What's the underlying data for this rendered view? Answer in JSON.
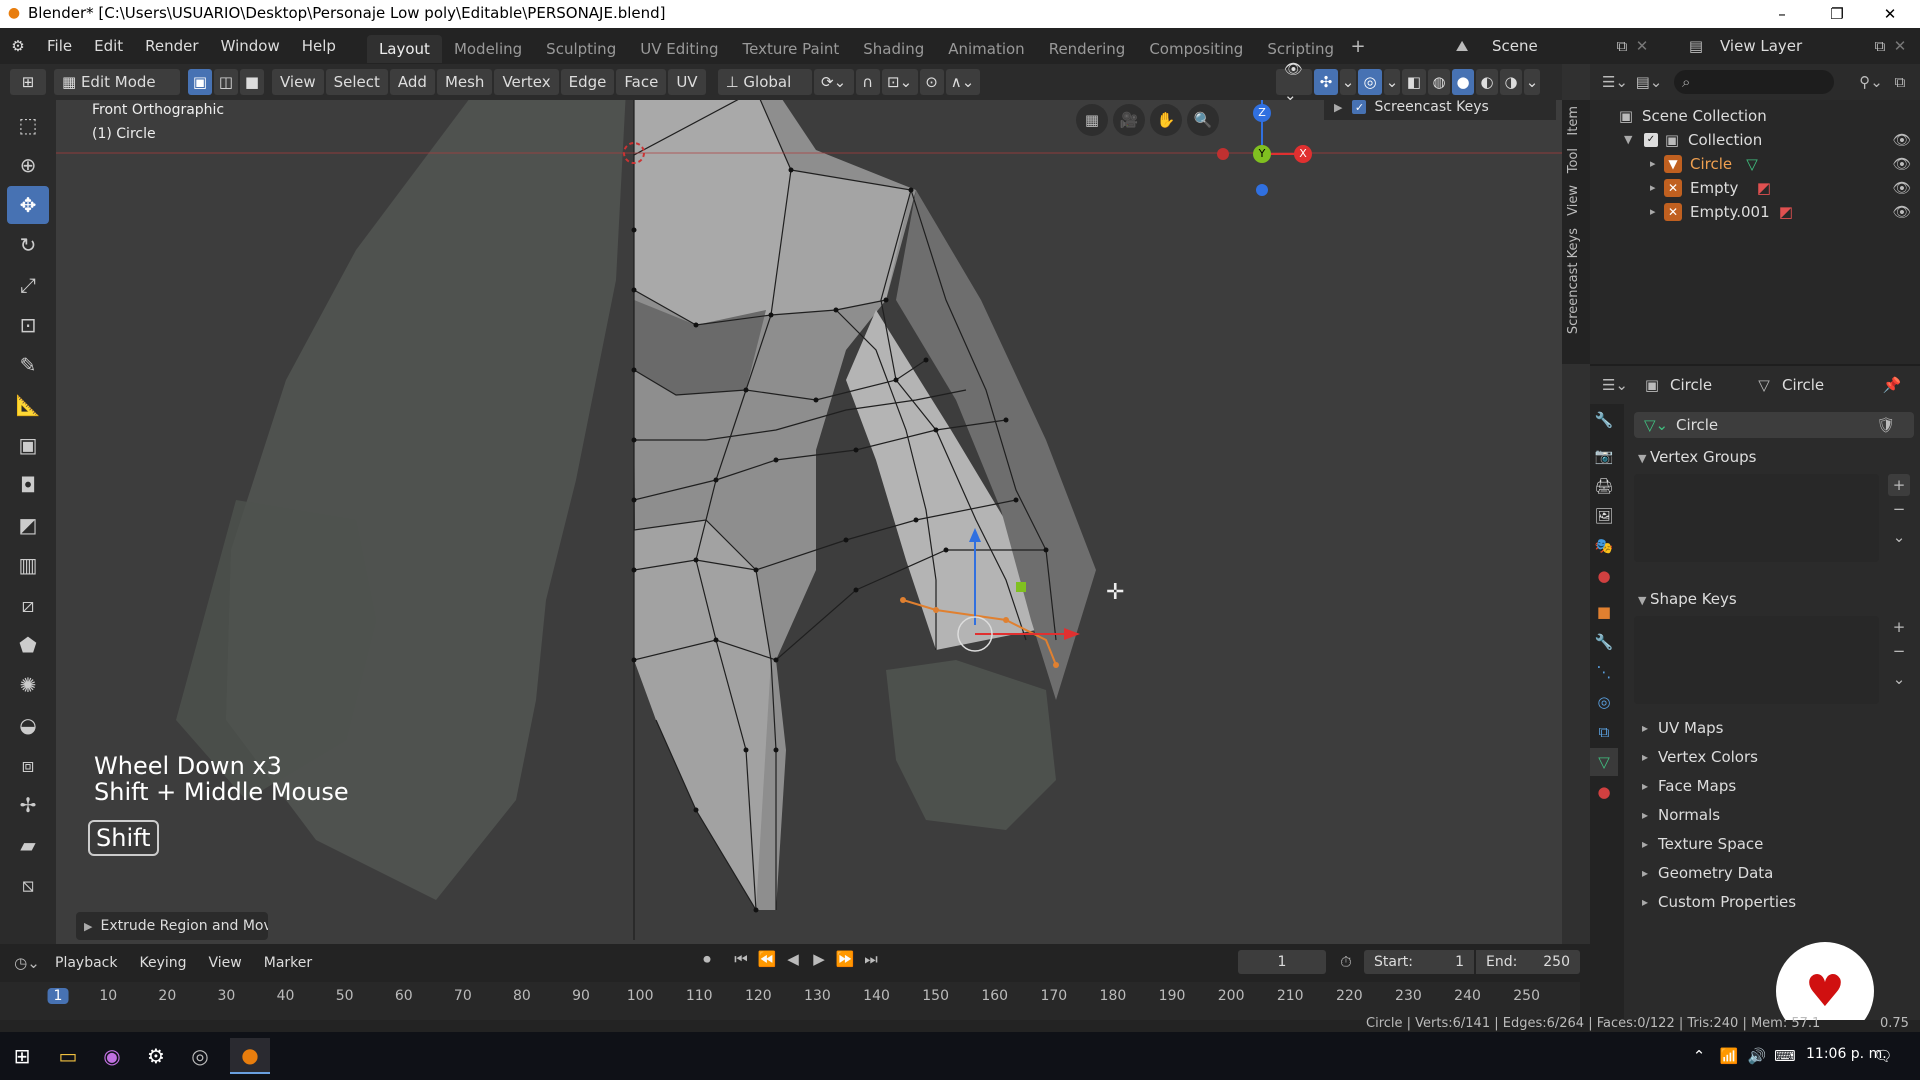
{
  "window": {
    "title": "Blender* [C:\\Users\\USUARIO\\Desktop\\Personaje Low poly\\Editable\\PERSONAJE.blend]"
  },
  "menu": {
    "file": "File",
    "edit": "Edit",
    "render": "Render",
    "window": "Window",
    "help": "Help"
  },
  "workspaces": [
    "Layout",
    "Modeling",
    "Sculpting",
    "UV Editing",
    "Texture Paint",
    "Shading",
    "Animation",
    "Rendering",
    "Compositing",
    "Scripting"
  ],
  "scene": {
    "label": "Scene",
    "view_layer": "View Layer"
  },
  "header": {
    "mode": "Edit Mode",
    "view": "View",
    "select": "Select",
    "add": "Add",
    "mesh": "Mesh",
    "vertex": "Vertex",
    "edge": "Edge",
    "face": "Face",
    "uv": "UV",
    "orientation": "Global"
  },
  "viewport": {
    "view_name": "Front Orthographic",
    "object_name": "(1) Circle",
    "screencast_label": "Screencast Keys",
    "keys_line1": "Wheel Down x3",
    "keys_line2": "Shift + Middle Mouse",
    "key_badge": "Shift",
    "last_op": "Extrude Region and Mov",
    "axis_z": "Z",
    "axis_y": "Y",
    "axis_x": "X"
  },
  "sidetabs": [
    "Item",
    "Tool",
    "View",
    "Screencast Keys"
  ],
  "outliner": {
    "scene_collection": "Scene Collection",
    "collection": "Collection",
    "items": [
      "Circle",
      "Empty",
      "Empty.001"
    ]
  },
  "properties": {
    "object": "Circle",
    "data": "Circle",
    "mesh_name": "Circle",
    "vertex_groups": "Vertex Groups",
    "shape_keys": "Shape Keys",
    "sections": [
      "UV Maps",
      "Vertex Colors",
      "Face Maps",
      "Normals",
      "Texture Space",
      "Geometry Data",
      "Custom Properties"
    ]
  },
  "timeline": {
    "playback": "Playback",
    "keying": "Keying",
    "view": "View",
    "marker": "Marker",
    "current_frame": "1",
    "start_label": "Start:",
    "start": "1",
    "end_label": "End:",
    "end": "250",
    "ticks": [
      "1",
      "10",
      "20",
      "30",
      "40",
      "50",
      "60",
      "70",
      "80",
      "90",
      "100",
      "110",
      "120",
      "130",
      "140",
      "150",
      "160",
      "170",
      "180",
      "190",
      "200",
      "210",
      "220",
      "230",
      "240",
      "250"
    ]
  },
  "status": {
    "text": "Circle | Verts:6/141 | Edges:6/264 | Faces:0/122 | Tris:240 | Mem: 57.1",
    "version": "0.75"
  },
  "taskbar": {
    "time": "11:06 p. m."
  },
  "colors": {
    "accent": "#4772b3",
    "selected": "#e08030",
    "x_axis": "#e03030",
    "y_axis": "#80c020",
    "z_axis": "#3070e0"
  }
}
